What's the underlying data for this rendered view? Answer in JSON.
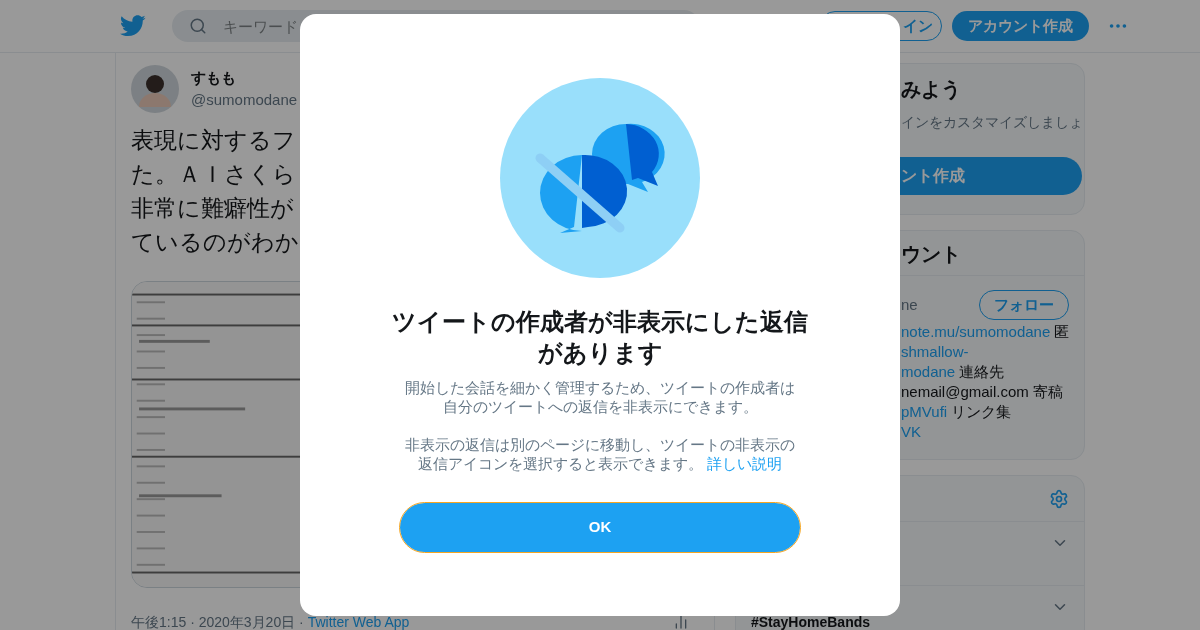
{
  "header": {
    "search_placeholder": "キーワード",
    "login_button": "イン",
    "signup_button": "アカウント作成"
  },
  "tweet": {
    "name": "すもも",
    "handle": "@sumomodane",
    "text_lines": [
      "表現に対するフ",
      "た。ＡＩさくら",
      "非常に難癖性が",
      "ているのがわか"
    ],
    "time": "午後1:15 · 2020年3月20日 · ",
    "source": "Twitter Web App"
  },
  "sidebar": {
    "signup_card": {
      "title": "みよう",
      "text": "インをカスタマイズしましょ",
      "button": "ント作成"
    },
    "accounts_card": {
      "title": "ウント",
      "handle": "ne",
      "follow_button": "フォロー",
      "bio_lines": [
        [
          {
            "text": "note.mu/sumomodane",
            "link": true
          },
          {
            "text": " 匿",
            "link": false
          }
        ],
        [
          {
            "text": "shmallow-",
            "link": true
          }
        ],
        [
          {
            "text": "modane",
            "link": true
          },
          {
            "text": " 連絡先",
            "link": false
          }
        ],
        [
          {
            "text": "nemail@gmail.com 寄稿",
            "link": false
          }
        ],
        [
          {
            "text": "pMVufi",
            "link": true
          },
          {
            "text": " リンク集",
            "link": false
          }
        ],
        [
          {
            "text": "VK",
            "link": true
          }
        ]
      ]
    },
    "trends_card": {
      "trend": "#StayHomeBands"
    }
  },
  "modal": {
    "title": "ツイートの作成者が非表示にした返信があります",
    "paragraphs": [
      {
        "text": "開始した会話を細かく管理するため、ツイートの作成者は自分のツイートへの返信を非表示にできます。"
      },
      {
        "text": "非表示の返信は別のページに移動し、ツイートの非表示の返信アイコンを選択すると表示できます。",
        "link": "詳しい説明"
      }
    ],
    "ok_button": {
      "label": "OK",
      "focused": true
    }
  }
}
